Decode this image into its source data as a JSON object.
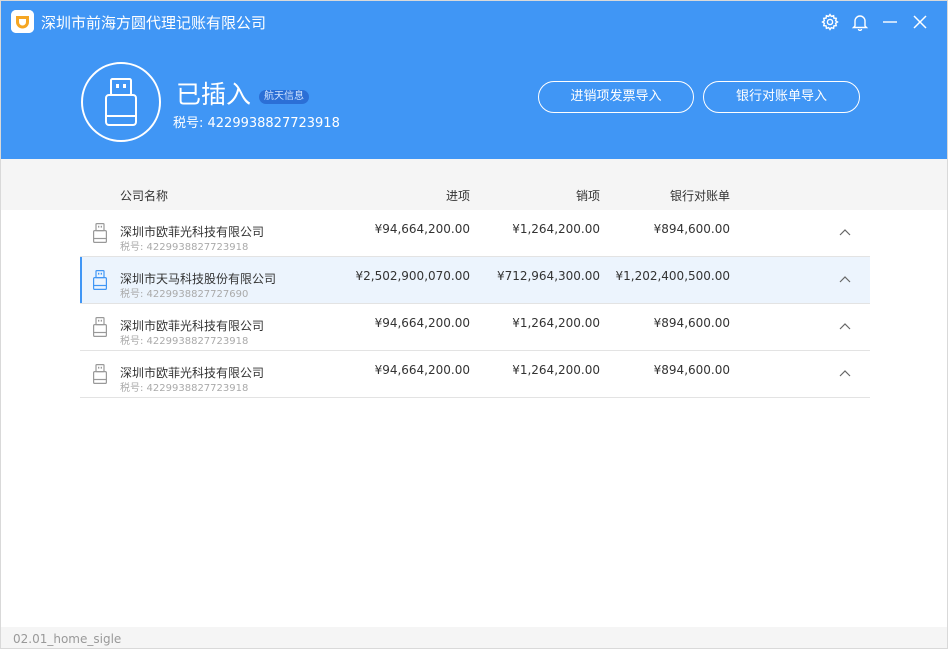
{
  "app": {
    "title": "深圳市前海方圆代理记账有限公司"
  },
  "device": {
    "status": "已插入",
    "tag": "航天信息",
    "tax_prefix": "税号: ",
    "tax_number": "4229938827723918"
  },
  "actions": {
    "import_invoices": "进销项发票导入",
    "import_bank": "银行对账单导入"
  },
  "table": {
    "headers": {
      "company": "公司名称",
      "input": "进项",
      "output": "销项",
      "bank": "银行对账单"
    },
    "rows": [
      {
        "name": "深圳市欧菲光科技有限公司",
        "tax": "税号: 4229938827723918",
        "input": "¥94,664,200.00",
        "output": "¥1,264,200.00",
        "bank": "¥894,600.00",
        "selected": false
      },
      {
        "name": "深圳市天马科技股份有限公司",
        "tax": "税号: 4229938827727690",
        "input": "¥2,502,900,070.00",
        "output": "¥712,964,300.00",
        "bank": "¥1,202,400,500.00",
        "selected": true
      },
      {
        "name": "深圳市欧菲光科技有限公司",
        "tax": "税号: 4229938827723918",
        "input": "¥94,664,200.00",
        "output": "¥1,264,200.00",
        "bank": "¥894,600.00",
        "selected": false
      },
      {
        "name": "深圳市欧菲光科技有限公司",
        "tax": "税号: 4229938827723918",
        "input": "¥94,664,200.00",
        "output": "¥1,264,200.00",
        "bank": "¥894,600.00",
        "selected": false
      }
    ]
  },
  "footer": {
    "label": "02.01_home_sigle"
  },
  "colors": {
    "header_bg": "#4096f5",
    "accent": "#4096f5",
    "selected_row_bg": "#ecf4fd",
    "tag_bg": "#2b6fd6"
  },
  "icons": {
    "app": "app-logo-icon",
    "settings": "gear-icon",
    "notifications": "bell-icon",
    "minimize": "minimize-icon",
    "close": "close-icon",
    "device": "usb-key-icon",
    "row_device": "usb-key-icon",
    "row_toggle": "chevron-up-icon"
  }
}
